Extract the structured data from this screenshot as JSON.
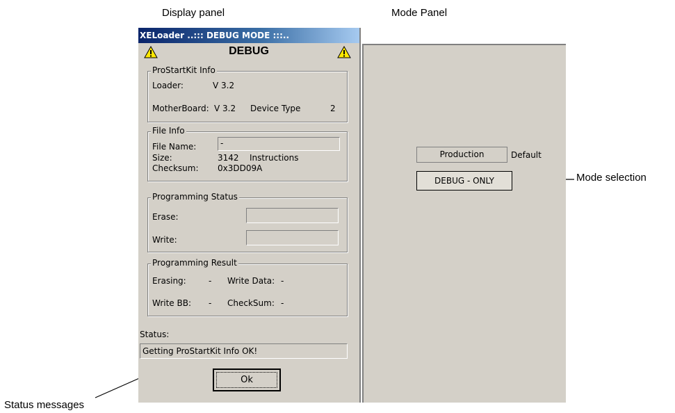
{
  "annotations": {
    "display_panel": "Display panel",
    "mode_panel": "Mode Panel",
    "mode_selection": "Mode selection",
    "status_messages": "Status messages"
  },
  "window": {
    "title": "XELoader ..::: DEBUG MODE :::..",
    "heading": "DEBUG",
    "icons": [
      "warning-icon",
      "warning-icon"
    ]
  },
  "prostartkit_info": {
    "legend": "ProStartKit Info",
    "loader_label": "Loader:",
    "loader_value": "V 3.2",
    "motherboard_label": "MotherBoard:",
    "motherboard_value": "V 3.2",
    "device_type_label": "Device Type",
    "device_type_value": "2"
  },
  "file_info": {
    "legend": "File Info",
    "file_name_label": "File Name:",
    "file_name_value": "-",
    "size_label": "Size:",
    "size_value": "3142",
    "size_unit": "Instructions",
    "checksum_label": "Checksum:",
    "checksum_value": "0x3DD09A"
  },
  "programming_status": {
    "legend": "Programming Status",
    "erase_label": "Erase:",
    "write_label": "Write:"
  },
  "programming_result": {
    "legend": "Programming Result",
    "erasing_label": "Erasing:",
    "erasing_value": "-",
    "write_data_label": "Write Data:",
    "write_data_value": "-",
    "write_bb_label": "Write BB:",
    "write_bb_value": "-",
    "checksum_label": "CheckSum:",
    "checksum_value": "-"
  },
  "status": {
    "label": "Status:",
    "message": "Getting ProStartKit Info OK!"
  },
  "ok_button": "Ok",
  "mode_panel": {
    "production_button": "Production",
    "production_note": "Default",
    "debug_only_button": "DEBUG - ONLY"
  },
  "colors": {
    "window_background": "#d4d0c8",
    "titlebar_start": "#0a246a",
    "titlebar_end": "#a6caf0",
    "warning_yellow": "#ffe800"
  }
}
